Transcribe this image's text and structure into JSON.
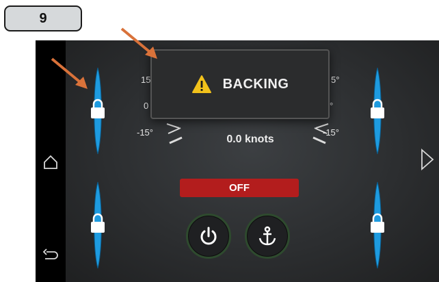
{
  "step_badge": "9",
  "popup": {
    "warning_icon": "warning-triangle-icon",
    "text": "BACKING"
  },
  "scale_labels": {
    "left_top": "15°",
    "left_mid": "0",
    "left_bottom": "-15°",
    "right_top": "5°",
    "right_mid": "°",
    "right_bottom": "-15°"
  },
  "speed": "0.0 knots",
  "status": {
    "label": "OFF",
    "color": "#b31d1d"
  },
  "buttons": {
    "power": "power-icon",
    "anchor": "anchor-icon"
  },
  "nav": {
    "home": "home-icon",
    "back": "back-icon",
    "next": "chevron-right-icon"
  },
  "colors": {
    "paddle": "#1e9be0",
    "callout_arrow": "#d9723a"
  }
}
